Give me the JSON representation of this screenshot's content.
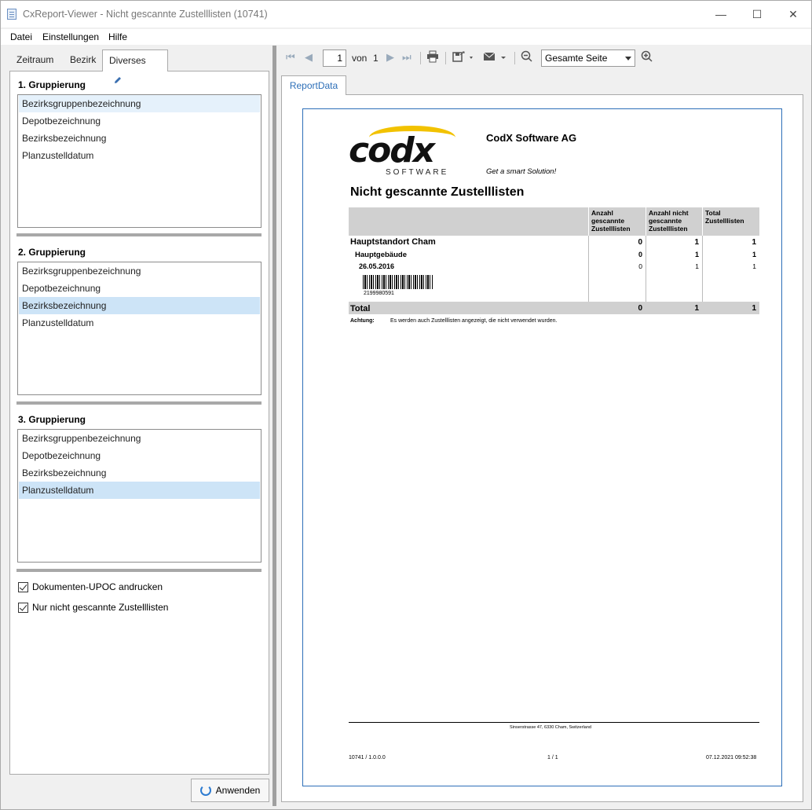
{
  "window": {
    "title": "CxReport-Viewer - Nicht gescannte Zustelllisten (10741)",
    "minimize": "—",
    "maximize": "☐",
    "close": "✕"
  },
  "menu": {
    "items": [
      "Datei",
      "Einstellungen",
      "Hilfe"
    ]
  },
  "tabs": {
    "items": [
      "Zeitraum",
      "Bezirk",
      "Diverses"
    ],
    "active": "Diverses"
  },
  "groups": [
    {
      "title": "1. Gruppierung",
      "items": [
        "Bezirksgruppenbezeichnung",
        "Depotbezeichnung",
        "Bezirksbezeichnung",
        "Planzustelldatum"
      ],
      "selected": 0
    },
    {
      "title": "2. Gruppierung",
      "items": [
        "Bezirksgruppenbezeichnung",
        "Depotbezeichnung",
        "Bezirksbezeichnung",
        "Planzustelldatum"
      ],
      "selected": 2
    },
    {
      "title": "3. Gruppierung",
      "items": [
        "Bezirksgruppenbezeichnung",
        "Depotbezeichnung",
        "Bezirksbezeichnung",
        "Planzustelldatum"
      ],
      "selected": 3
    }
  ],
  "options": [
    {
      "label": "Dokumenten-UPOC andrucken",
      "checked": true
    },
    {
      "label": "Nur nicht gescannte Zustelllisten",
      "checked": true
    }
  ],
  "apply_label": "Anwenden",
  "toolbar": {
    "page": "1",
    "of_label": "von",
    "total_pages": "1",
    "zoom": "Gesamte Seite"
  },
  "report_tab": "ReportData",
  "report": {
    "logo": "codx",
    "logo_sub": "SOFTWARE",
    "company": "CodX Software AG",
    "slogan": "Get a smart Solution!",
    "title": "Nicht gescannte Zustelllisten",
    "columns": [
      "Anzahl gescannte Zustelllisten",
      "Anzahl nicht gescannte Zustelllisten",
      "Total Zustelllisten"
    ],
    "rows": [
      {
        "label": "Hauptstandort Cham",
        "values": [
          "0",
          "1",
          "1"
        ]
      },
      {
        "label": "Hauptgebäude",
        "values": [
          "0",
          "1",
          "1"
        ]
      },
      {
        "label": "26.05.2016",
        "values": [
          "0",
          "1",
          "1"
        ]
      }
    ],
    "barcode_number": "2199980591",
    "total_label": "Total",
    "total_values": [
      "0",
      "1",
      "1"
    ],
    "note_label": "Achtung:",
    "note_text": "Es werden auch Zustelllisten angezeigt, die nicht verwendet wurden.",
    "address": "Sinserstrasse 47, 6330 Cham, Switzerland",
    "version": "10741 / 1.0.0.0",
    "page_of": "1 / 1",
    "timestamp": "07.12.2021 09:52:38"
  }
}
